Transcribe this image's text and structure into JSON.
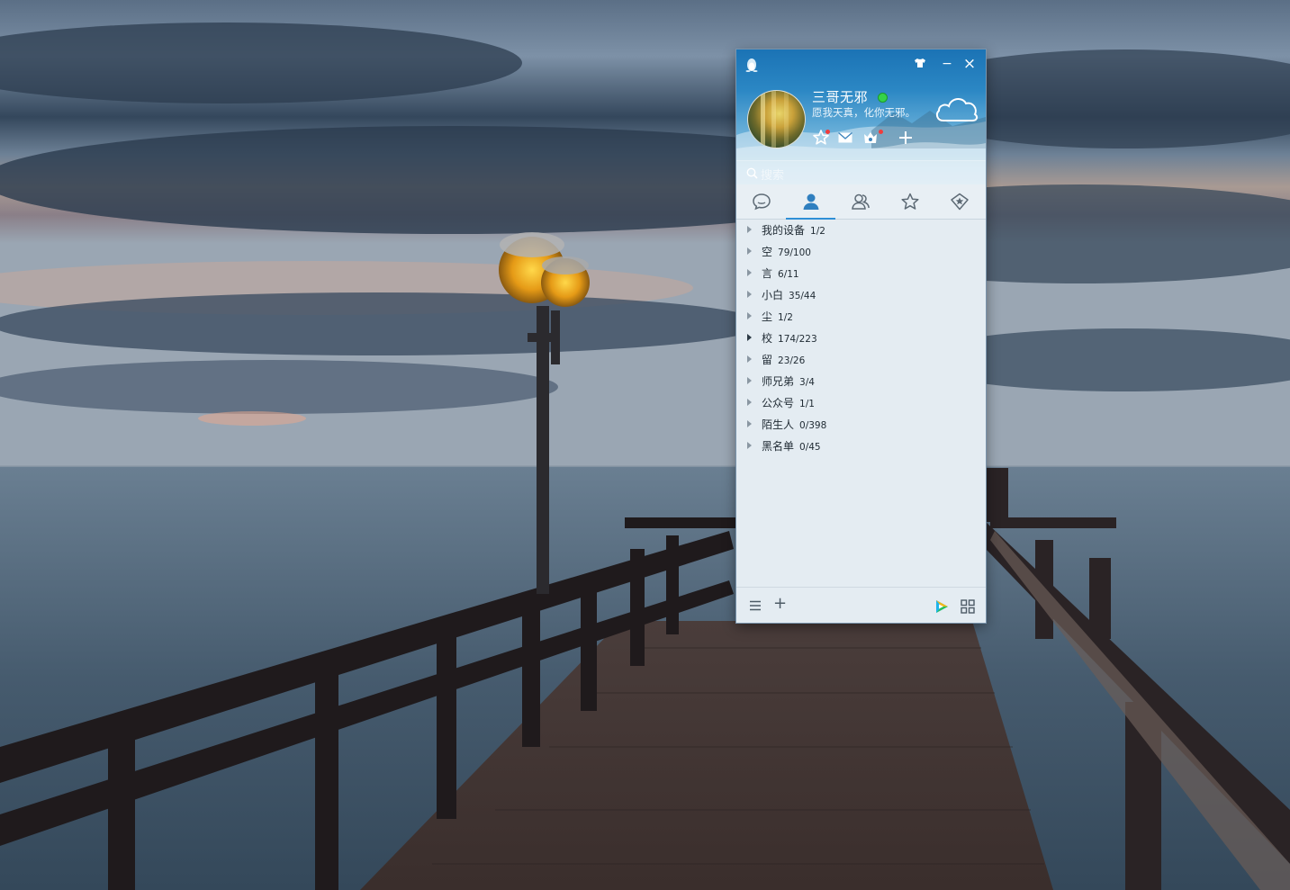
{
  "window": {
    "app": "QQ",
    "skin_icon": "tshirt-icon",
    "minimize_label": "−",
    "close_label": "×"
  },
  "profile": {
    "nickname": "三哥无邪",
    "signature": "愿我天真，化你无邪。",
    "status": "online",
    "status_color": "#35d24a"
  },
  "search": {
    "placeholder": "搜索"
  },
  "tabs": [
    {
      "name": "messages",
      "icon": "chat-bubble-icon"
    },
    {
      "name": "contacts",
      "icon": "person-icon",
      "active": true
    },
    {
      "name": "groups",
      "icon": "people-icon"
    },
    {
      "name": "favorites",
      "icon": "star-icon"
    },
    {
      "name": "discover",
      "icon": "diamond-star-icon"
    }
  ],
  "groups": [
    {
      "name": "我的设备",
      "count": "1/2"
    },
    {
      "name": "空",
      "count": "79/100"
    },
    {
      "name": "言",
      "count": "6/11"
    },
    {
      "name": "小白",
      "count": "35/44"
    },
    {
      "name": "尘",
      "count": "1/2"
    },
    {
      "name": "校",
      "count": "174/223"
    },
    {
      "name": "留",
      "count": "23/26"
    },
    {
      "name": "师兄弟",
      "count": "3/4"
    },
    {
      "name": "公众号",
      "count": "1/1"
    },
    {
      "name": "陌生人",
      "count": "0/398"
    },
    {
      "name": "黑名单",
      "count": "0/45"
    }
  ],
  "bottom": {
    "menu_icon": "hamburger-menu-icon",
    "add_label": "+",
    "play_icon": "tencent-video-icon",
    "apps_icon": "app-grid-icon"
  },
  "colors": {
    "header_top": "#1b73b5",
    "accent": "#2f8fd6",
    "panel_bg": "#e4ecf2"
  }
}
